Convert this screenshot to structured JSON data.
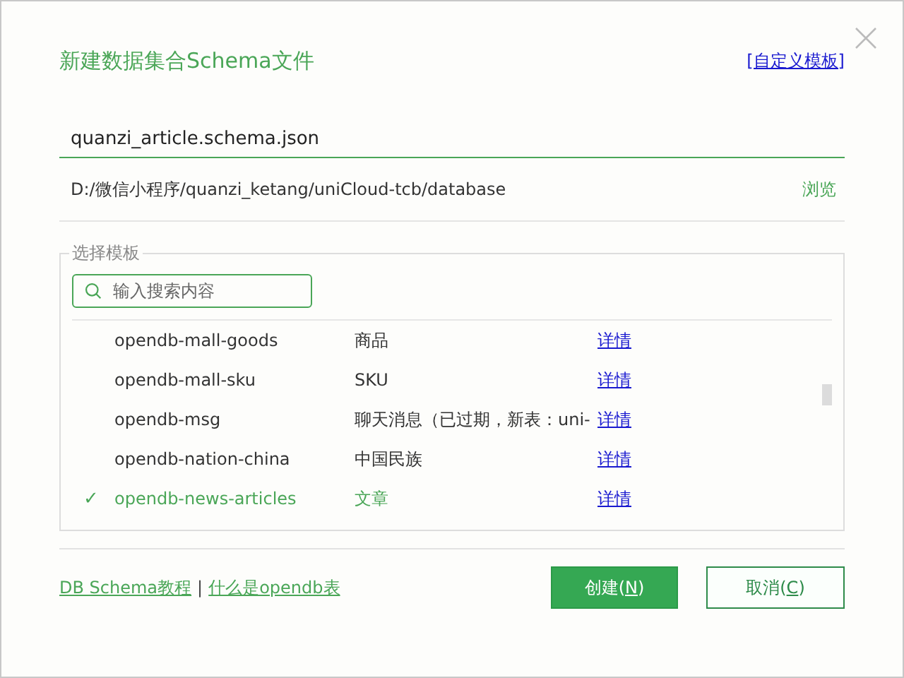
{
  "window": {
    "title": "新建数据集合Schema文件",
    "custom_template_link": "[自定义模板]"
  },
  "filename": {
    "value": "quanzi_article.schema.json"
  },
  "path": {
    "value": "D:/微信小程序/quanzi_ketang/uniCloud-tcb/database",
    "browse": "浏览"
  },
  "templates": {
    "legend": "选择模板",
    "check_mark": "✓",
    "search": {
      "placeholder": "输入搜索内容"
    },
    "rows": [
      {
        "name": "opendb-mall-goods",
        "description": "商品",
        "link": "详情",
        "selected": false
      },
      {
        "name": "opendb-mall-sku",
        "description": "SKU",
        "link": "详情",
        "selected": false
      },
      {
        "name": "opendb-msg",
        "description": "聊天消息（已过期，新表：uni-",
        "link": "详情",
        "selected": false
      },
      {
        "name": "opendb-nation-china",
        "description": "中国民族",
        "link": "详情",
        "selected": false
      },
      {
        "name": "opendb-news-articles",
        "description": "文章",
        "link": "详情",
        "selected": true
      }
    ]
  },
  "footer": {
    "links": [
      "DB Schema教程",
      "什么是opendb表"
    ],
    "separator": "|",
    "buttons": [
      {
        "label": "创建(",
        "key": "N",
        "close": ")",
        "kind": "primary"
      },
      {
        "label": "取消(",
        "key": "C",
        "close": ")",
        "kind": "secondary"
      }
    ]
  }
}
